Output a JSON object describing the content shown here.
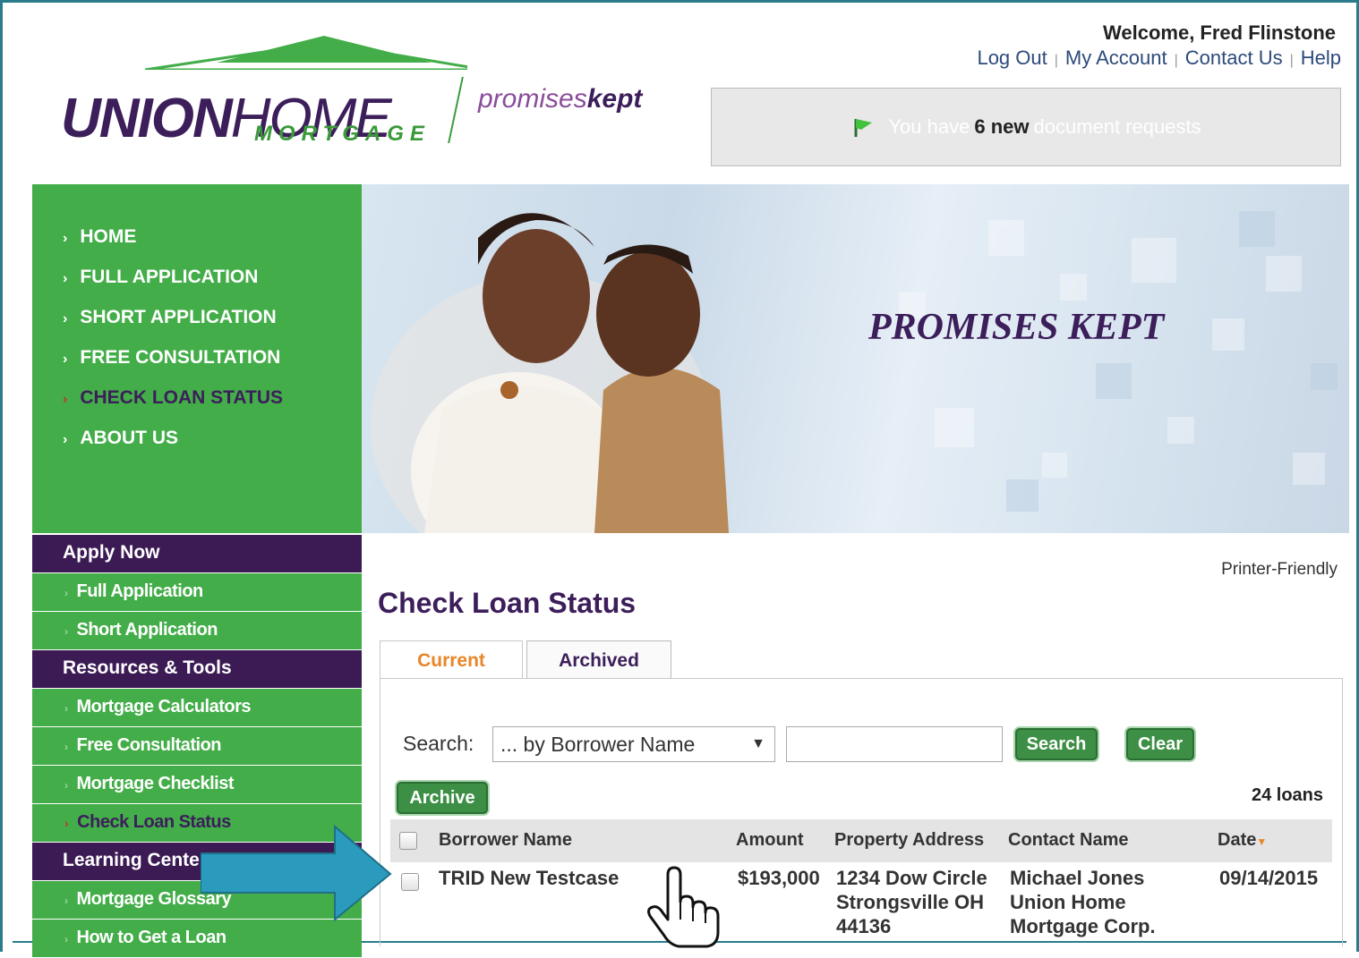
{
  "brand": {
    "name_bold": "UNION",
    "name_light": "HOME",
    "sub": "MORTGAGE",
    "tagline_light": "promises",
    "tagline_bold": "kept"
  },
  "header": {
    "welcome": "Welcome, Fred Flinstone",
    "links": [
      "Log Out",
      "My Account",
      "Contact Us",
      "Help"
    ],
    "notice": {
      "prefix": "You have",
      "count": "6 new",
      "suffix": "document requests"
    }
  },
  "main_nav": [
    "HOME",
    "FULL APPLICATION",
    "SHORT APPLICATION",
    "FREE CONSULTATION",
    "CHECK LOAN STATUS",
    "ABOUT US"
  ],
  "hero": {
    "text": "PROMISES KEPT"
  },
  "sidebar": {
    "apply_header": "Apply Now",
    "apply_items": [
      "Full Application",
      "Short Application"
    ],
    "resources_header": "Resources & Tools",
    "resources_items": [
      "Mortgage Calculators",
      "Free Consultation",
      "Mortgage Checklist",
      "Check Loan Status"
    ],
    "learning_header": "Learning Center",
    "learning_items": [
      "Mortgage Glossary",
      "How to Get a Loan"
    ]
  },
  "page": {
    "printer_friendly": "Printer-Friendly",
    "title": "Check Loan Status",
    "tabs": [
      "Current",
      "Archived"
    ],
    "search_label": "Search:",
    "search_select": "... by Borrower Name",
    "search_button": "Search",
    "clear_button": "Clear",
    "archive_button": "Archive",
    "loan_count": "24 loans"
  },
  "table": {
    "columns": [
      "Borrower Name",
      "Amount",
      "Property Address",
      "Contact Name",
      "Date"
    ],
    "rows": [
      {
        "borrower": "TRID New Testcase",
        "amount": "$193,000",
        "address": [
          "1234 Dow Circle",
          "Strongsville OH",
          "44136"
        ],
        "contact": [
          "Michael Jones",
          "Union Home",
          "Mortgage Corp."
        ],
        "date": "09/14/2015"
      }
    ]
  },
  "colors": {
    "brand_purple": "#3c1e5a",
    "brand_green": "#43ad49",
    "accent_orange": "#e8862a",
    "frame_teal": "#2a7c8c",
    "arrow_blue": "#2a9bbd"
  },
  "icons": [
    "flag-icon",
    "chevron-right-icon",
    "sort-down-icon",
    "pointer-hand-icon",
    "callout-arrow-icon"
  ]
}
